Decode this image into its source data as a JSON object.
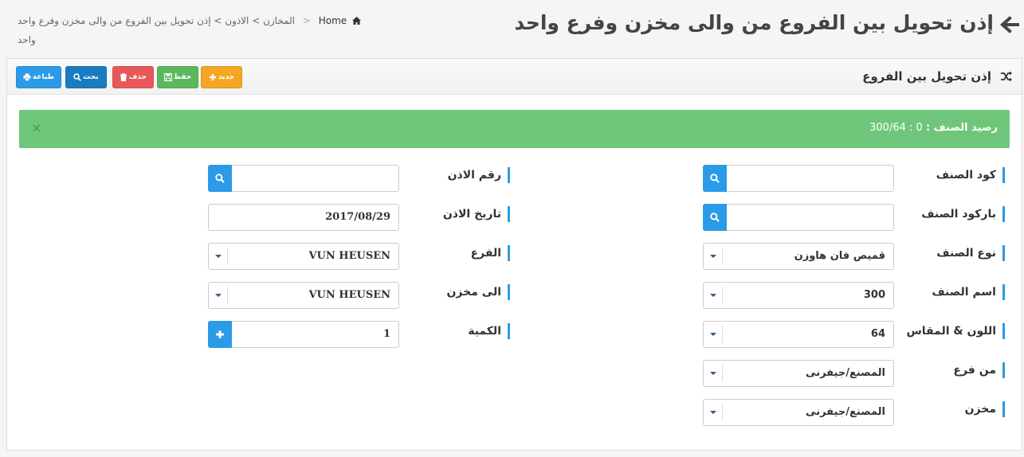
{
  "header": {
    "title": "إذن تحويل بين الفروع من والى مخزن وفرع واحد",
    "breadcrumb": {
      "home": "Home",
      "path": "المخازن > الاذون > إذن تحويل بين الفروع من والى مخزن وفرع واحد",
      "sub": "واحد"
    }
  },
  "panel": {
    "title": "إذن تحويل بين الفروع",
    "toolbar": {
      "new_label": "جديد",
      "save_label": "حفظ",
      "delete_label": "حذف",
      "search_label": "بحث",
      "print_label": "طباعة"
    }
  },
  "alert": {
    "label": "رصيد الصنف :",
    "value": "300/64 : 0",
    "close": "×"
  },
  "form": {
    "item_code": {
      "label": "كود الصنف",
      "value": ""
    },
    "item_barcode": {
      "label": "باركود الصنف",
      "value": ""
    },
    "item_type": {
      "label": "نوع الصنف",
      "value": "قميص فان هاوزن"
    },
    "item_name": {
      "label": "اسم الصنف",
      "value": "300"
    },
    "color_size": {
      "label": "اللون & المقاس",
      "value": "64"
    },
    "from_branch": {
      "label": "من فرع",
      "value": "المصنع/جيفرنى"
    },
    "store": {
      "label": "مخزن",
      "value": "المصنع/جيفرنى"
    },
    "permit_number": {
      "label": "رقم الاذن",
      "value": ""
    },
    "permit_date": {
      "label": "تاريخ الاذن",
      "value": "2017/08/29"
    },
    "branch": {
      "label": "الفرع",
      "value": "VUN HEUSEN"
    },
    "to_store": {
      "label": "الى مخزن",
      "value": "VUN HEUSEN"
    },
    "quantity": {
      "label": "الكمية",
      "value": "1"
    }
  },
  "colors": {
    "primary": "#2b9be8",
    "success": "#6fc67a",
    "warning": "#f5a623",
    "save": "#5cb85c",
    "danger": "#e8585a",
    "search": "#1a7bbf"
  },
  "icons": [
    "back-arrow-icon",
    "home-icon",
    "shuffle-icon",
    "plus-icon",
    "save-icon",
    "trash-icon",
    "search-icon",
    "print-icon",
    "close-icon",
    "chevron-down-icon"
  ]
}
